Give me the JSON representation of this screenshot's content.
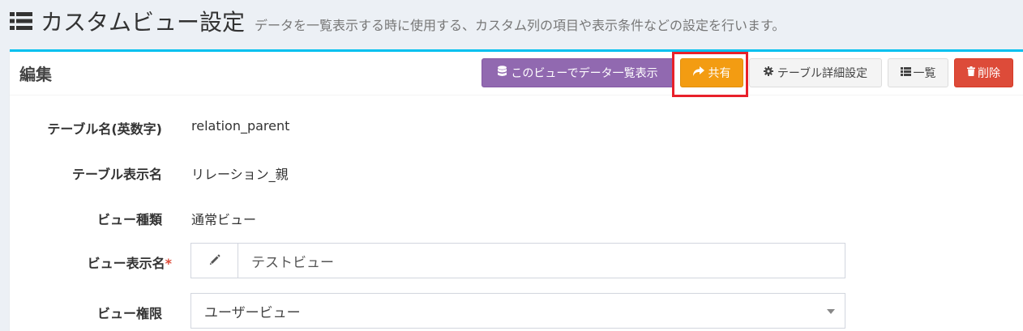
{
  "header": {
    "title": "カスタムビュー設定",
    "subtitle": "データを一覧表示する時に使用する、カスタム列の項目や表示条件などの設定を行います。",
    "icon": "list-icon"
  },
  "box": {
    "title": "編集",
    "accent_color": "#00c0ef",
    "buttons": {
      "view_data": {
        "label": "このビューでデータ一覧表示",
        "icon": "database-icon"
      },
      "share": {
        "label": "共有",
        "icon": "share-icon"
      },
      "table_settings": {
        "label": "テーブル詳細設定",
        "icon": "gear-icon"
      },
      "list": {
        "label": "一覧",
        "icon": "list-icon"
      },
      "delete": {
        "label": "削除",
        "icon": "trash-icon"
      }
    }
  },
  "form": {
    "table_name": {
      "label": "テーブル名(英数字)",
      "value": "relation_parent"
    },
    "table_display_name": {
      "label": "テーブル表示名",
      "value": "リレーション_親"
    },
    "view_type": {
      "label": "ビュー種類",
      "value": "通常ビュー"
    },
    "view_display_name": {
      "label": "ビュー表示名",
      "required_mark": "*",
      "value": "テストビュー",
      "icon": "pencil-icon"
    },
    "view_permission": {
      "label": "ビュー権限",
      "value": "ユーザービュー"
    }
  },
  "colors": {
    "purple": "#9169b0",
    "orange": "#f39c12",
    "red": "#dd4b39",
    "highlight": "#e8202a"
  }
}
